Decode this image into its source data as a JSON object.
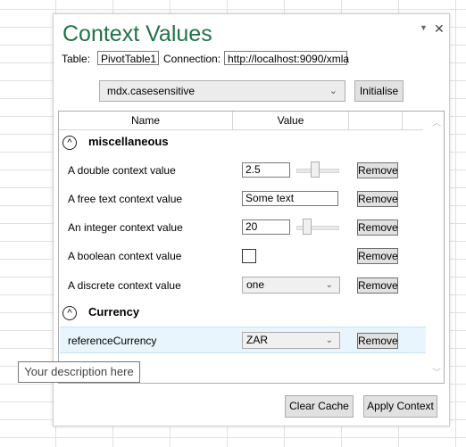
{
  "pane": {
    "title": "Context Values",
    "menu_glyph": "▼",
    "close_glyph": "✕",
    "table_label": "Table:",
    "table_value": "PivotTable1",
    "connection_label": "Connection:",
    "connection_value": "http://localhost:9090/xmla",
    "context_selector": "mdx.casesensitive",
    "initialise_label": "Initialise",
    "clear_cache_label": "Clear Cache",
    "apply_context_label": "Apply Context"
  },
  "grid": {
    "columns": [
      "Name",
      "Value"
    ],
    "groups": [
      {
        "label": "miscellaneous",
        "toggle": "^"
      },
      {
        "label": "Currency",
        "toggle": "^"
      }
    ],
    "rows": [
      {
        "name": "A double context value",
        "value": "2.5",
        "slider_level": 0.45,
        "action": "Remove"
      },
      {
        "name": "A free text context value",
        "value": "Some text",
        "action": "Remove"
      },
      {
        "name": "An integer context value",
        "value": "20",
        "slider_level": 0.2,
        "action": "Remove"
      },
      {
        "name": "A boolean context value",
        "value": false,
        "action": "Remove"
      },
      {
        "name": "A discrete context value",
        "value": "one",
        "action": "Remove"
      },
      {
        "name": "referenceCurrency",
        "value": "ZAR",
        "action": "Remove"
      }
    ]
  },
  "icons": {
    "dropdown": "chevron-down-icon",
    "collapse": "chevron-up-circle-icon"
  },
  "tooltip": "Your description here",
  "colors": {
    "title": "#217346",
    "selected_row": "#e8f5fc"
  }
}
